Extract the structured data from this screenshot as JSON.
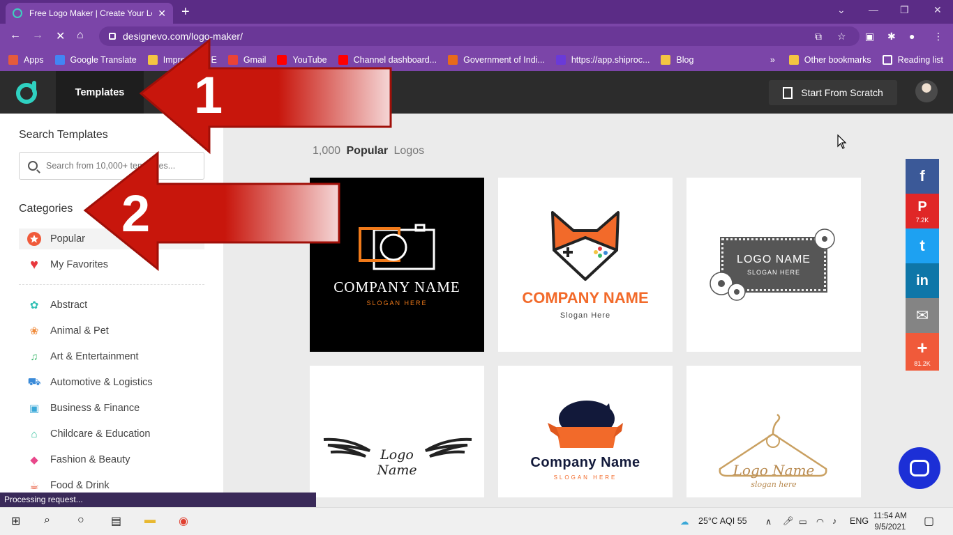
{
  "browser": {
    "tab_title": "Free Logo Maker | Create Your Lo",
    "url": "designevo.com/logo-maker/",
    "bookmarks": [
      {
        "label": "Apps",
        "icon": "apps-grid-icon",
        "color": "#e55b3c"
      },
      {
        "label": "Google Translate",
        "icon": "translate-icon",
        "color": "#4285f4"
      },
      {
        "label": "Impressum IE",
        "icon": "folder-icon",
        "color": "#f4c542"
      },
      {
        "label": "Gmail",
        "icon": "gmail-icon",
        "color": "#ea4335"
      },
      {
        "label": "YouTube",
        "icon": "youtube-icon",
        "color": "#ff0000"
      },
      {
        "label": "Channel dashboard...",
        "icon": "youtube-icon",
        "color": "#ff0000"
      },
      {
        "label": "Government of Indi...",
        "icon": "emblem-icon",
        "color": "#e86a1a"
      },
      {
        "label": "https://app.shiproc...",
        "icon": "shiprocket-icon",
        "color": "#6a3ad8"
      },
      {
        "label": "Blog",
        "icon": "folder-icon",
        "color": "#f4c542"
      }
    ],
    "other_bookmarks": "Other bookmarks",
    "reading_list": "Reading list"
  },
  "header": {
    "templates_label": "Templates",
    "start_scratch_label": "Start From Scratch"
  },
  "sidebar": {
    "search_title": "Search Templates",
    "search_placeholder": "Search from 10,000+ templates...",
    "categories_title": "Categories",
    "top_items": [
      {
        "label": "Popular",
        "icon": "star-icon",
        "active": true
      },
      {
        "label": "My Favorites",
        "icon": "heart-icon",
        "active": false
      }
    ],
    "items": [
      {
        "label": "Abstract",
        "icon": "abstract-icon"
      },
      {
        "label": "Animal & Pet",
        "icon": "paw-icon"
      },
      {
        "label": "Art & Entertainment",
        "icon": "music-note-icon"
      },
      {
        "label": "Automotive & Logistics",
        "icon": "car-icon"
      },
      {
        "label": "Business & Finance",
        "icon": "briefcase-icon"
      },
      {
        "label": "Childcare & Education",
        "icon": "graduation-cap-icon"
      },
      {
        "label": "Fashion & Beauty",
        "icon": "diamond-icon"
      },
      {
        "label": "Food & Drink",
        "icon": "food-icon"
      }
    ]
  },
  "main": {
    "count": "1,000",
    "count_bold": "Popular",
    "count_suffix": "Logos",
    "cards": [
      {
        "name": "COMPANY NAME",
        "tagline": "SLOGAN HERE",
        "style": "camera"
      },
      {
        "name": "COMPANY NAME",
        "tagline": "Slogan Here",
        "style": "fox"
      },
      {
        "name": "LOGO NAME",
        "tagline": "SLOGAN HERE",
        "style": "floral"
      },
      {
        "name": "Logo Name",
        "tagline": "",
        "style": "wings"
      },
      {
        "name": "Company Name",
        "tagline": "SLOGAN HERE",
        "style": "cat"
      },
      {
        "name": "Logo Name",
        "tagline": "slogan here",
        "style": "hanger"
      }
    ]
  },
  "share": [
    {
      "icon": "facebook-icon",
      "glyph": "f",
      "color": "#3b5998",
      "count": ""
    },
    {
      "icon": "pinterest-icon",
      "glyph": "P",
      "color": "#e02727",
      "count": "7.2K"
    },
    {
      "icon": "twitter-icon",
      "glyph": "t",
      "color": "#1da1f2",
      "count": ""
    },
    {
      "icon": "linkedin-icon",
      "glyph": "in",
      "color": "#0e76a8",
      "count": ""
    },
    {
      "icon": "email-icon",
      "glyph": "✉",
      "color": "#848484",
      "count": ""
    },
    {
      "icon": "plus-icon",
      "glyph": "+",
      "color": "#f05a3a",
      "count": "81.2K"
    }
  ],
  "annotations": {
    "arrow1": "1",
    "arrow2": "2"
  },
  "status_text": "Processing request...",
  "taskbar": {
    "weather": "25°C AQI 55",
    "lang": "ENG",
    "time": "11:54 AM",
    "date": "9/5/2021"
  }
}
